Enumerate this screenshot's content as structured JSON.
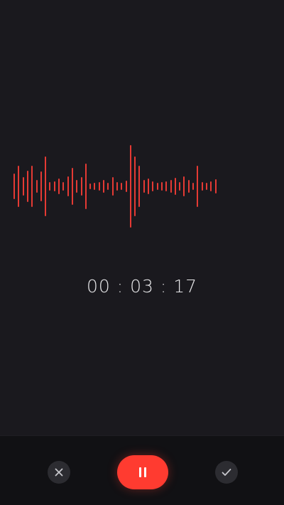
{
  "theme": {
    "background": "#1a191e",
    "bottom_bar": "#111114",
    "accent": "#ff3b30",
    "waveform_color": "#e53a34",
    "icon_color": "#c7c7cc"
  },
  "recorder": {
    "elapsed_time": "00 : 03 : 17"
  },
  "controls": {
    "discard_icon": "close-icon",
    "pause_icon": "pause-icon",
    "save_icon": "checkmark-icon"
  }
}
